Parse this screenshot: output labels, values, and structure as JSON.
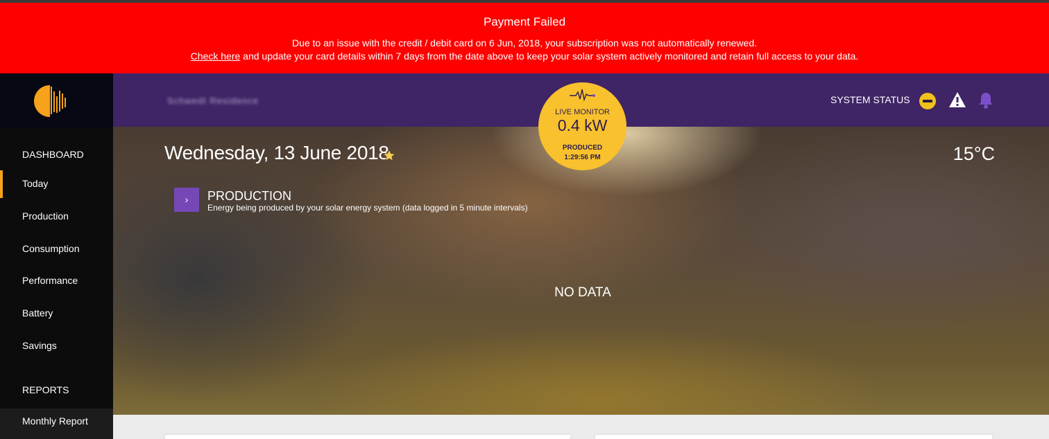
{
  "banner": {
    "title": "Payment Failed",
    "line1": "Due to an issue with the credit / debit card on 6 Jun, 2018, your subscription was not automatically renewed.",
    "link": "Check here",
    "line2_rest": " and update your card details within 7 days from the date above to keep your solar system actively monitored and retain full access to your data.",
    "color": "#ff0000"
  },
  "sidebar": {
    "dashboard_heading": "DASHBOARD",
    "items": [
      {
        "label": "Today",
        "active": true
      },
      {
        "label": "Production"
      },
      {
        "label": "Consumption"
      },
      {
        "label": "Performance"
      },
      {
        "label": "Battery"
      },
      {
        "label": "Savings"
      }
    ],
    "reports_heading": "REPORTS",
    "report_items": [
      {
        "label": "Monthly Report"
      }
    ],
    "accent": "#f7a21b"
  },
  "header": {
    "site_name": "Schwedt Residence",
    "system_status_label": "SYSTEM STATUS",
    "icons": [
      "minus-circle-icon",
      "warning-icon",
      "bell-icon"
    ],
    "color": "#3f2466"
  },
  "live_monitor": {
    "label": "LIVE MONITOR",
    "value": "0.4 kW",
    "produced_label": "PRODUCED",
    "produced_time": "1:29:56 PM",
    "color": "#f8c12d"
  },
  "main": {
    "date": "Wednesday, 13 June 2018",
    "temperature": "15°C",
    "production": {
      "title": "PRODUCTION",
      "description": "Energy being produced by your solar energy system (data logged in 5 minute intervals)",
      "toggle_glyph": "›"
    },
    "no_data": "NO DATA"
  }
}
